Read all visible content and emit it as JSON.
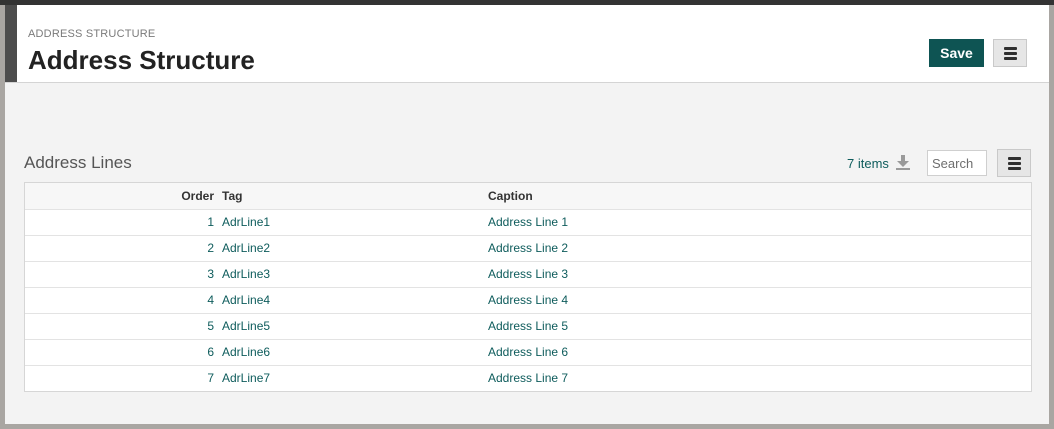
{
  "header": {
    "breadcrumb": "ADDRESS STRUCTURE",
    "title": "Address Structure",
    "save_label": "Save"
  },
  "section": {
    "title": "Address Lines",
    "items_count": "7 items",
    "search_placeholder": "Search"
  },
  "table": {
    "columns": [
      "Order",
      "Tag",
      "Caption"
    ],
    "rows": [
      {
        "order": "1",
        "tag": "AdrLine1",
        "caption": "Address Line 1"
      },
      {
        "order": "2",
        "tag": "AdrLine2",
        "caption": "Address Line 2"
      },
      {
        "order": "3",
        "tag": "AdrLine3",
        "caption": "Address Line 3"
      },
      {
        "order": "4",
        "tag": "AdrLine4",
        "caption": "Address Line 4"
      },
      {
        "order": "5",
        "tag": "AdrLine5",
        "caption": "Address Line 5"
      },
      {
        "order": "6",
        "tag": "AdrLine6",
        "caption": "Address Line 6"
      },
      {
        "order": "7",
        "tag": "AdrLine7",
        "caption": "Address Line 7"
      }
    ]
  },
  "icons": {
    "download": "download-icon",
    "menu": "hamburger-menu-icon"
  },
  "colors": {
    "accent": "#0e5453",
    "link": "#0e5c5c",
    "header_bar": "#4d4d4d"
  }
}
